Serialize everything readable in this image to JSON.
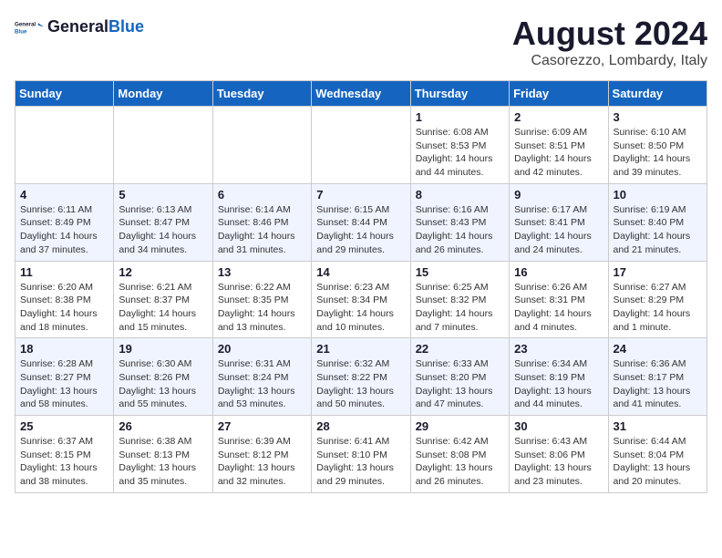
{
  "header": {
    "logo_line1": "General",
    "logo_line2": "Blue",
    "month_year": "August 2024",
    "location": "Casorezzo, Lombardy, Italy"
  },
  "weekdays": [
    "Sunday",
    "Monday",
    "Tuesday",
    "Wednesday",
    "Thursday",
    "Friday",
    "Saturday"
  ],
  "weeks": [
    [
      {
        "day": "",
        "info": ""
      },
      {
        "day": "",
        "info": ""
      },
      {
        "day": "",
        "info": ""
      },
      {
        "day": "",
        "info": ""
      },
      {
        "day": "1",
        "info": "Sunrise: 6:08 AM\nSunset: 8:53 PM\nDaylight: 14 hours\nand 44 minutes."
      },
      {
        "day": "2",
        "info": "Sunrise: 6:09 AM\nSunset: 8:51 PM\nDaylight: 14 hours\nand 42 minutes."
      },
      {
        "day": "3",
        "info": "Sunrise: 6:10 AM\nSunset: 8:50 PM\nDaylight: 14 hours\nand 39 minutes."
      }
    ],
    [
      {
        "day": "4",
        "info": "Sunrise: 6:11 AM\nSunset: 8:49 PM\nDaylight: 14 hours\nand 37 minutes."
      },
      {
        "day": "5",
        "info": "Sunrise: 6:13 AM\nSunset: 8:47 PM\nDaylight: 14 hours\nand 34 minutes."
      },
      {
        "day": "6",
        "info": "Sunrise: 6:14 AM\nSunset: 8:46 PM\nDaylight: 14 hours\nand 31 minutes."
      },
      {
        "day": "7",
        "info": "Sunrise: 6:15 AM\nSunset: 8:44 PM\nDaylight: 14 hours\nand 29 minutes."
      },
      {
        "day": "8",
        "info": "Sunrise: 6:16 AM\nSunset: 8:43 PM\nDaylight: 14 hours\nand 26 minutes."
      },
      {
        "day": "9",
        "info": "Sunrise: 6:17 AM\nSunset: 8:41 PM\nDaylight: 14 hours\nand 24 minutes."
      },
      {
        "day": "10",
        "info": "Sunrise: 6:19 AM\nSunset: 8:40 PM\nDaylight: 14 hours\nand 21 minutes."
      }
    ],
    [
      {
        "day": "11",
        "info": "Sunrise: 6:20 AM\nSunset: 8:38 PM\nDaylight: 14 hours\nand 18 minutes."
      },
      {
        "day": "12",
        "info": "Sunrise: 6:21 AM\nSunset: 8:37 PM\nDaylight: 14 hours\nand 15 minutes."
      },
      {
        "day": "13",
        "info": "Sunrise: 6:22 AM\nSunset: 8:35 PM\nDaylight: 14 hours\nand 13 minutes."
      },
      {
        "day": "14",
        "info": "Sunrise: 6:23 AM\nSunset: 8:34 PM\nDaylight: 14 hours\nand 10 minutes."
      },
      {
        "day": "15",
        "info": "Sunrise: 6:25 AM\nSunset: 8:32 PM\nDaylight: 14 hours\nand 7 minutes."
      },
      {
        "day": "16",
        "info": "Sunrise: 6:26 AM\nSunset: 8:31 PM\nDaylight: 14 hours\nand 4 minutes."
      },
      {
        "day": "17",
        "info": "Sunrise: 6:27 AM\nSunset: 8:29 PM\nDaylight: 14 hours\nand 1 minute."
      }
    ],
    [
      {
        "day": "18",
        "info": "Sunrise: 6:28 AM\nSunset: 8:27 PM\nDaylight: 13 hours\nand 58 minutes."
      },
      {
        "day": "19",
        "info": "Sunrise: 6:30 AM\nSunset: 8:26 PM\nDaylight: 13 hours\nand 55 minutes."
      },
      {
        "day": "20",
        "info": "Sunrise: 6:31 AM\nSunset: 8:24 PM\nDaylight: 13 hours\nand 53 minutes."
      },
      {
        "day": "21",
        "info": "Sunrise: 6:32 AM\nSunset: 8:22 PM\nDaylight: 13 hours\nand 50 minutes."
      },
      {
        "day": "22",
        "info": "Sunrise: 6:33 AM\nSunset: 8:20 PM\nDaylight: 13 hours\nand 47 minutes."
      },
      {
        "day": "23",
        "info": "Sunrise: 6:34 AM\nSunset: 8:19 PM\nDaylight: 13 hours\nand 44 minutes."
      },
      {
        "day": "24",
        "info": "Sunrise: 6:36 AM\nSunset: 8:17 PM\nDaylight: 13 hours\nand 41 minutes."
      }
    ],
    [
      {
        "day": "25",
        "info": "Sunrise: 6:37 AM\nSunset: 8:15 PM\nDaylight: 13 hours\nand 38 minutes."
      },
      {
        "day": "26",
        "info": "Sunrise: 6:38 AM\nSunset: 8:13 PM\nDaylight: 13 hours\nand 35 minutes."
      },
      {
        "day": "27",
        "info": "Sunrise: 6:39 AM\nSunset: 8:12 PM\nDaylight: 13 hours\nand 32 minutes."
      },
      {
        "day": "28",
        "info": "Sunrise: 6:41 AM\nSunset: 8:10 PM\nDaylight: 13 hours\nand 29 minutes."
      },
      {
        "day": "29",
        "info": "Sunrise: 6:42 AM\nSunset: 8:08 PM\nDaylight: 13 hours\nand 26 minutes."
      },
      {
        "day": "30",
        "info": "Sunrise: 6:43 AM\nSunset: 8:06 PM\nDaylight: 13 hours\nand 23 minutes."
      },
      {
        "day": "31",
        "info": "Sunrise: 6:44 AM\nSunset: 8:04 PM\nDaylight: 13 hours\nand 20 minutes."
      }
    ]
  ]
}
